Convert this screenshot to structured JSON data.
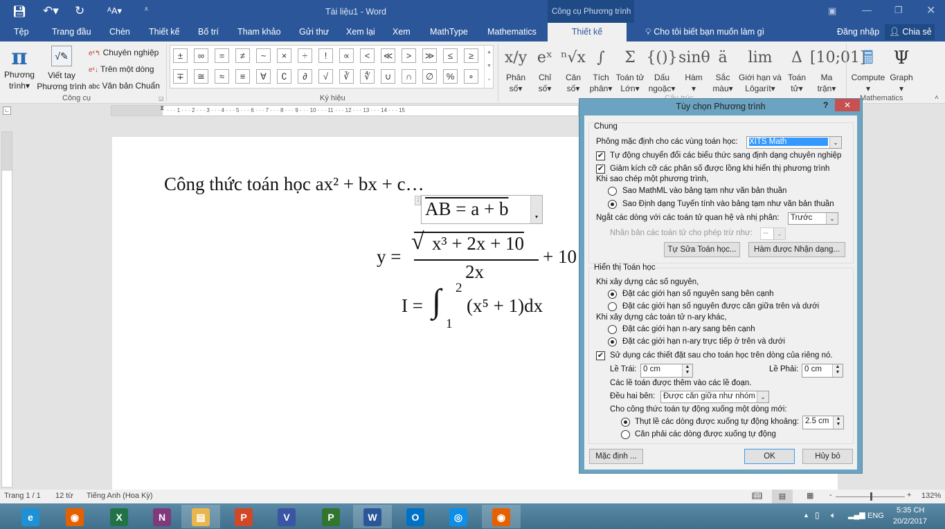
{
  "titlebar": {
    "title": "Tài liệu1 - Word",
    "context_title": "Công cụ Phương trình"
  },
  "tabs": [
    "Tệp",
    "Trang đầu",
    "Chèn",
    "Thiết kế",
    "Bố trí",
    "Tham khảo",
    "Gửi thư",
    "Xem lại",
    "Xem",
    "MathType",
    "Mathematics"
  ],
  "active_tab": "Thiết kế",
  "tellme": "Cho tôi biết bạn muốn làm gì",
  "signin": "Đăng nhập",
  "share": "Chia sẻ",
  "tools": {
    "equation_l1": "Phương",
    "equation_l2": "trình",
    "ink_l1": "Viết tay",
    "ink_l2": "Phương trình",
    "professional": "Chuyên nghiệp",
    "linear": "Trên một dòng",
    "normal_text": "Văn bản Chuẩn",
    "group": "Công cụ"
  },
  "symbols": {
    "row1": [
      "±",
      "∞",
      "=",
      "≠",
      "~",
      "×",
      "÷",
      "!",
      "∝",
      "<",
      "≪",
      ">",
      "≫",
      "≤",
      "≥"
    ],
    "row2": [
      "∓",
      "≅",
      "≈",
      "≡",
      "∀",
      "∁",
      "∂",
      "√",
      "∛",
      "∜",
      "∪",
      "∩",
      "∅",
      "%",
      "∘"
    ],
    "group": "Ký hiệu"
  },
  "structures": {
    "group": "Cấu trúc",
    "items": [
      {
        "glyph": "x/y",
        "l1": "Phân",
        "l2": "số"
      },
      {
        "glyph": "eˣ",
        "l1": "Chỉ",
        "l2": "số"
      },
      {
        "glyph": "ⁿ√x",
        "l1": "Căn",
        "l2": "số"
      },
      {
        "glyph": "∫",
        "l1": "Tích",
        "l2": "phân"
      },
      {
        "glyph": "Σ",
        "l1": "Toán tử",
        "l2": "Lớn"
      },
      {
        "glyph": "{()}",
        "l1": "Dấu",
        "l2": "ngoặc"
      },
      {
        "glyph": "sinθ",
        "l1": "Hàm",
        "l2": ""
      },
      {
        "glyph": "ä",
        "l1": "Sắc",
        "l2": "màu"
      },
      {
        "glyph": "lim",
        "l1": "Giới hạn và",
        "l2": "Lôgarít"
      },
      {
        "glyph": "Δ",
        "l1": "Toán",
        "l2": "tử"
      },
      {
        "glyph": "[10;01]",
        "l1": "Ma",
        "l2": "trận"
      }
    ]
  },
  "mathematics": {
    "compute": "Compute",
    "graph": "Graph",
    "group": "Mathematics"
  },
  "document": {
    "line1": "Công thức toán học ax² + bx + c…",
    "eq1": "AB = a + b",
    "eq2_lhs": "y =",
    "eq2_num": "x³ + 2x + 10",
    "eq2_den": "2x",
    "eq2_tail": "+ 10",
    "eq3": "I =",
    "eq3_upper": "2",
    "eq3_lower": "1",
    "eq3_body": "(x⁵ + 1)dx"
  },
  "dialog": {
    "title": "Tùy chọn Phương trình",
    "help": "?",
    "general": "Chung",
    "font_label": "Phông mặc định cho các vùng toán học:",
    "font_value": "XITS Math",
    "cb1": "Tự động chuyển đổi các biểu thức sang định dạng chuyên nghiệp",
    "cb1_checked": true,
    "cb2": "Giảm kích cỡ các phân số được lồng khi hiển thị phương trình",
    "cb2_checked": true,
    "copy_heading": "Khi sao chép một phương trình,",
    "copy_r1": "Sao MathML vào bảng tạm như văn bản thuần",
    "copy_r2": "Sao Định dạng Tuyến tính vào bảng tạm như văn bản thuần",
    "copy_selected": 2,
    "break_label": "Ngắt các dòng với các toán tử quan hệ và nhị phân:",
    "break_value": "Trước",
    "dup_label": "Nhân bản các toán tử cho phép trừ như:",
    "dup_value": "--",
    "autocorrect_btn": "Tự Sửa Toán học...",
    "recognized_btn": "Hàm được Nhận dạng...",
    "display": "Hiển thị Toán học",
    "int_heading": "Khi xây dựng các số nguyên,",
    "int_r1": "Đặt các giới hạn số nguyên sang bên cạnh",
    "int_r2": "Đặt các giới hạn số nguyên được căn giữa trên và dưới",
    "int_selected": 1,
    "nary_heading": "Khi xây dựng các toán tử n-ary khác,",
    "nary_r1": "Đặt các giới hạn n-ary sang bên cạnh",
    "nary_r2": "Đặt các giới hạn n-ary trực tiếp ở trên và dưới",
    "nary_selected": 2,
    "cb3": "Sử dụng các thiết đặt sau cho toán học trên dòng của riêng nó.",
    "cb3_checked": true,
    "left_label": "Lề Trái:",
    "left_value": "0 cm",
    "right_label": "Lề Phải:",
    "right_value": "0 cm",
    "margins_note": "Các lề toán được thêm vào các lề đoạn.",
    "justify_label": "Đều hai bên:",
    "justify_value": "Được căn giữa như nhóm",
    "wrap_heading": "Cho công thức toán tự động xuống một dòng mới:",
    "wrap_r1": "Thụt lề các dòng được xuống tự động khoảng:",
    "wrap_value": "2.5 cm",
    "wrap_r2": "Căn phải các dòng được xuống tự động",
    "wrap_selected": 1,
    "defaults_btn": "Mặc định ...",
    "ok_btn": "OK",
    "cancel_btn": "Hủy bỏ"
  },
  "status": {
    "page": "Trang 1 / 1",
    "words": "12 từ",
    "language": "Tiếng Anh (Hoa Kỳ)",
    "zoom": "132%",
    "zoom_fraction": 0.6
  },
  "taskbar": {
    "apps": [
      {
        "name": "internet-explorer",
        "letter": "e",
        "color": "#1e90d6"
      },
      {
        "name": "firefox",
        "letter": "◉",
        "color": "#e66000"
      },
      {
        "name": "excel",
        "letter": "X",
        "color": "#217346"
      },
      {
        "name": "onenote",
        "letter": "N",
        "color": "#80397b"
      },
      {
        "name": "file-explorer",
        "letter": "▤",
        "color": "#e8b64c"
      },
      {
        "name": "powerpoint",
        "letter": "P",
        "color": "#d24726"
      },
      {
        "name": "visio",
        "letter": "V",
        "color": "#3955a3"
      },
      {
        "name": "project",
        "letter": "P",
        "color": "#31752f"
      },
      {
        "name": "word",
        "letter": "W",
        "color": "#2b579a"
      },
      {
        "name": "outlook",
        "letter": "O",
        "color": "#0072c6"
      },
      {
        "name": "teamviewer",
        "letter": "◎",
        "color": "#0e8ee9"
      },
      {
        "name": "firefox",
        "letter": "◉",
        "color": "#e66000"
      }
    ],
    "lang": "ENG",
    "time": "5:35 CH",
    "date": "20/2/2017"
  }
}
